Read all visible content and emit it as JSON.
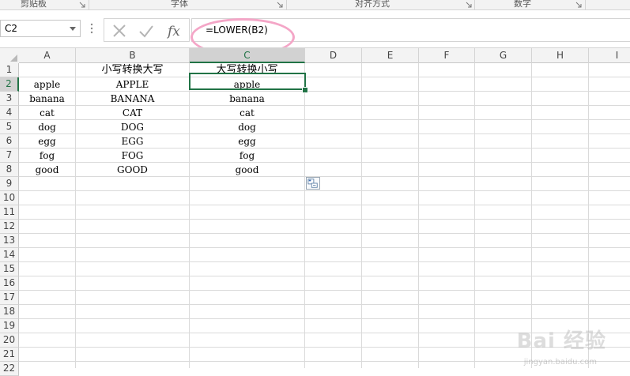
{
  "ribbon": {
    "groups": [
      "剪贴板",
      "字体",
      "对齐方式",
      "数字"
    ]
  },
  "formula_bar": {
    "name_box": "C2",
    "formula": "=LOWER(B2)"
  },
  "columns": [
    "A",
    "B",
    "C",
    "D",
    "E",
    "F",
    "G",
    "H",
    "I"
  ],
  "rows": [
    "1",
    "2",
    "3",
    "4",
    "5",
    "6",
    "7",
    "8",
    "9",
    "10",
    "11",
    "12",
    "13",
    "14",
    "15",
    "16",
    "17",
    "18",
    "19",
    "20",
    "21",
    "22"
  ],
  "cells": {
    "B1": "小写转换大写",
    "C1": "大写转换小写",
    "A2": "apple",
    "B2": "APPLE",
    "C2": "apple",
    "A3": "banana",
    "B3": "BANANA",
    "C3": "banana",
    "A4": "cat",
    "B4": "CAT",
    "C4": "cat",
    "A5": "dog",
    "B5": "DOG",
    "C5": "dog",
    "A6": "egg",
    "B6": "EGG",
    "C6": "egg",
    "A7": "fog",
    "B7": "FOG",
    "C7": "fog",
    "A8": "good",
    "B8": "GOOD",
    "C8": "good"
  },
  "watermark": {
    "main": "Bai 经验",
    "sub": "jingyan.baidu.com"
  },
  "colors": {
    "accent": "#217346",
    "highlight": "#f4a6c7"
  },
  "icons": {
    "cancel": "close-icon",
    "enter": "check-icon",
    "fx": "function-icon",
    "paste_options": "paste-options-icon"
  }
}
